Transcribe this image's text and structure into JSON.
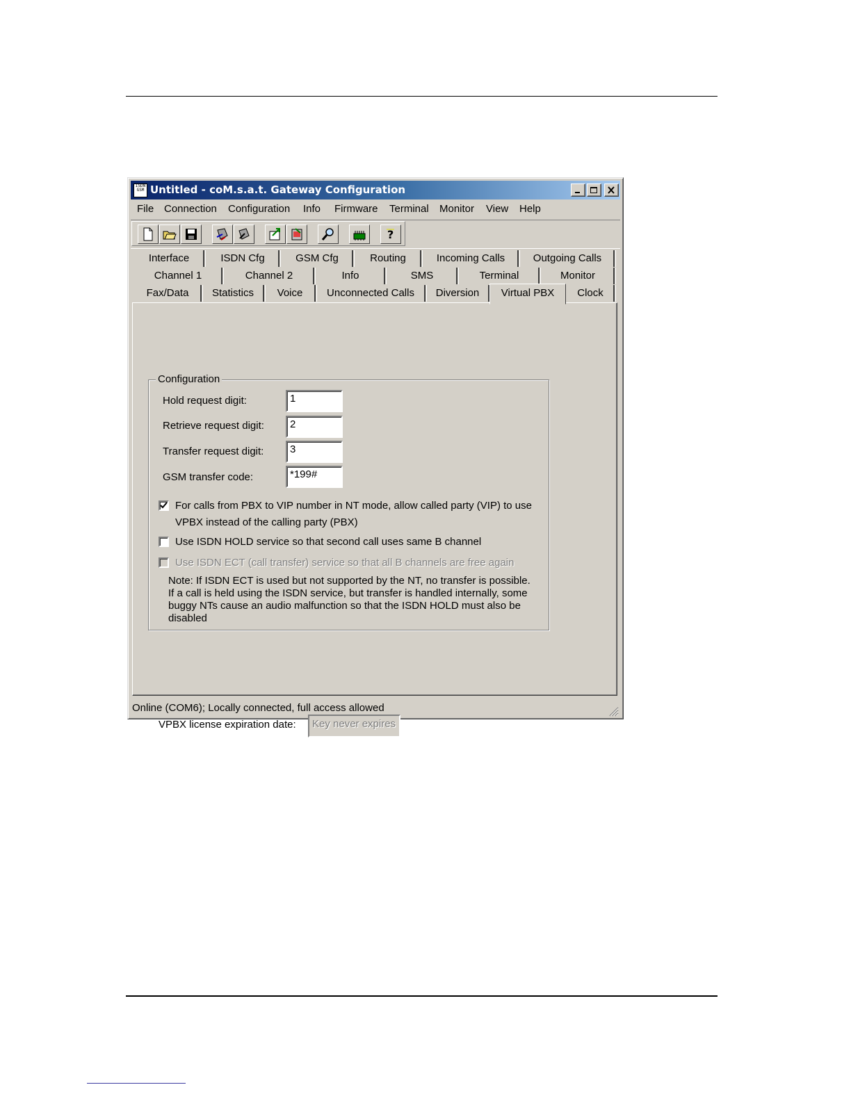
{
  "window": {
    "title": "Untitled - coM.s.a.t. Gateway Configuration",
    "icon_text": "ISDN GSM"
  },
  "menu": [
    "File",
    "Connection",
    "Configuration",
    "Info",
    "Firmware",
    "Terminal",
    "Monitor",
    "View",
    "Help"
  ],
  "toolbar": [
    "new-icon",
    "open-icon",
    "save-icon",
    "download-icon",
    "upload-icon",
    "export-icon",
    "import-icon",
    "search-icon",
    "chip-icon",
    "help-icon"
  ],
  "tabs": {
    "row1": [
      "Interface",
      "ISDN Cfg",
      "GSM Cfg",
      "Routing",
      "Incoming Calls",
      "Outgoing Calls"
    ],
    "row2": [
      "Channel 1",
      "Channel 2",
      "Info",
      "SMS",
      "Terminal",
      "Monitor"
    ],
    "row3": [
      "Fax/Data",
      "Statistics",
      "Voice",
      "Unconnected Calls",
      "Diversion",
      "Virtual PBX",
      "Clock"
    ],
    "active": "Virtual PBX"
  },
  "config": {
    "group_title": "Configuration",
    "hold_label": "Hold request digit:",
    "hold_value": "1",
    "retrieve_label": "Retrieve request digit:",
    "retrieve_value": "2",
    "transfer_label": "Transfer request digit:",
    "transfer_value": "3",
    "gsm_label": "GSM transfer code:",
    "gsm_value": "*199#",
    "cb_vip_label": "For calls from PBX to VIP number in NT mode, allow called party (VIP) to use VPBX instead of the calling party (PBX)",
    "cb_vip_checked": true,
    "cb_hold_label": "Use ISDN HOLD service so that second call uses same B channel",
    "cb_hold_checked": false,
    "cb_ect_label": "Use ISDN ECT (call transfer) service so that all B channels are free again",
    "cb_ect_checked": false,
    "note": "Note: If ISDN ECT is used but not supported by the NT, no transfer is possible. If a call is held using the ISDN service, but transfer is handled internally, some buggy NTs cause an audio malfunction so that the ISDN HOLD must also be disabled"
  },
  "license": {
    "label": "VPBX license expiration date:",
    "value": "Key never expires"
  },
  "status": "Online (COM6); Locally connected, full access allowed"
}
